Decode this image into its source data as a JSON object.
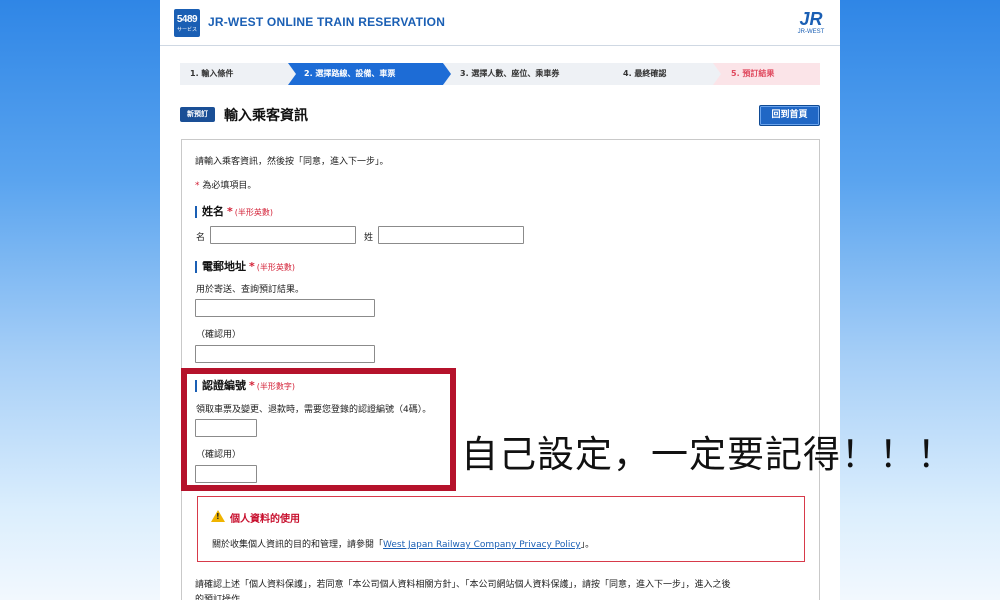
{
  "header": {
    "logo_number": "5489",
    "logo_sub": "サービス",
    "app_title": "JR-WEST ONLINE TRAIN RESERVATION",
    "jr_logo": "JR",
    "jr_logo_sub": "JR-WEST"
  },
  "steps": [
    {
      "label": "1.  輸入條件"
    },
    {
      "label": "2. 選擇路線、設備、車票"
    },
    {
      "label": "3. 選擇人數、座位、乘車券"
    },
    {
      "label": "4. 最終確認"
    },
    {
      "label": "5. 預訂結果"
    }
  ],
  "title_row": {
    "badge": "新預訂",
    "title": "輸入乘客資訊",
    "home_button": "回到首頁"
  },
  "form": {
    "intro": "請輸入乘客資訊，然後按「同意，進入下一步」。",
    "required_mark": "*",
    "required_note": "為必填項目。",
    "name": {
      "title": "姓名",
      "star": "*",
      "note": "(半形英數)",
      "first_label": "名",
      "last_label": "姓",
      "first_value": "",
      "last_value": ""
    },
    "email": {
      "title": "電郵地址",
      "star": "*",
      "note": "(半形英數)",
      "desc": "用於寄送、查詢預訂結果。",
      "confirm_label": "（確認用）",
      "value": "",
      "confirm_value": ""
    },
    "auth": {
      "title": "認證編號",
      "star": "*",
      "note": "(半形數字)",
      "desc": "領取車票及變更、退款時，需要您登錄的認證編號（4碼）。",
      "confirm_label": "（確認用）",
      "value": "",
      "confirm_value": ""
    },
    "privacy": {
      "icon": "warning-icon",
      "title": "個人資料的使用",
      "text_before": "關於收集個人資訊的目的和管理，請參閱「",
      "link": "West Japan Railway Company Privacy Policy",
      "text_after": "」。"
    },
    "bottom_line1": "請確認上述「個人資料保護」，若同意「本公司個人資料相關方針」、「本公司網站個人資料保護」，請按「同意，進入下一步」，進入之後",
    "bottom_line2": "的預訂操作。"
  },
  "annotation": "自己設定，一定要記得！！！",
  "colors": {
    "brand_blue": "#1a5fb4",
    "active_step": "#1d6cd6",
    "required_red": "#d31f35",
    "highlight_red": "#b5122b"
  }
}
